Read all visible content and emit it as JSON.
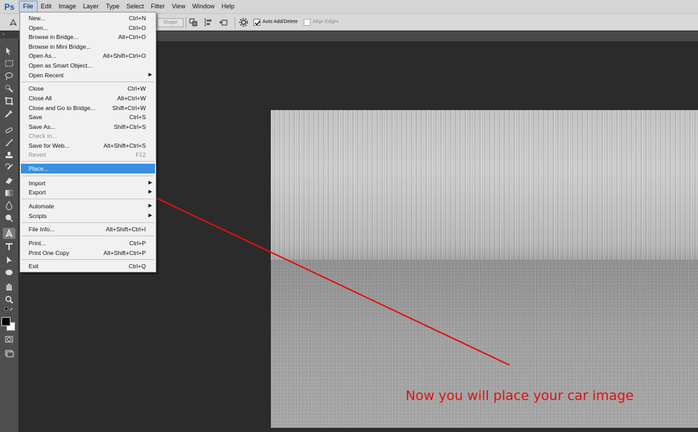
{
  "app": {
    "logo": "Ps"
  },
  "menubar": {
    "items": [
      "File",
      "Edit",
      "Image",
      "Layer",
      "Type",
      "Select",
      "Filter",
      "View",
      "Window",
      "Help"
    ]
  },
  "options": {
    "shape_label": "Shape",
    "auto_add_delete": "Auto Add/Delete",
    "auto_add_delete_checked": true,
    "align_edges": "Align Edges",
    "align_edges_checked": false
  },
  "file_menu": {
    "items": [
      {
        "label": "New...",
        "shortcut": "Ctrl+N"
      },
      {
        "label": "Open...",
        "shortcut": "Ctrl+O"
      },
      {
        "label": "Browse in Bridge...",
        "shortcut": "Alt+Ctrl+O"
      },
      {
        "label": "Browse in Mini Bridge...",
        "shortcut": ""
      },
      {
        "label": "Open As...",
        "shortcut": "Alt+Shift+Ctrl+O"
      },
      {
        "label": "Open as Smart Object...",
        "shortcut": ""
      },
      {
        "label": "Open Recent",
        "shortcut": "",
        "submenu": true
      },
      {
        "label": "Close",
        "shortcut": "Ctrl+W"
      },
      {
        "label": "Close All",
        "shortcut": "Alt+Ctrl+W"
      },
      {
        "label": "Close and Go to Bridge...",
        "shortcut": "Shift+Ctrl+W"
      },
      {
        "label": "Save",
        "shortcut": "Ctrl+S"
      },
      {
        "label": "Save As...",
        "shortcut": "Shift+Ctrl+S"
      },
      {
        "label": "Check In...",
        "shortcut": "",
        "disabled": true
      },
      {
        "label": "Save for Web...",
        "shortcut": "Alt+Shift+Ctrl+S"
      },
      {
        "label": "Revert",
        "shortcut": "F12",
        "disabled": true
      },
      {
        "label": "Place...",
        "shortcut": "",
        "highlighted": true
      },
      {
        "label": "Import",
        "shortcut": "",
        "submenu": true
      },
      {
        "label": "Export",
        "shortcut": "",
        "submenu": true
      },
      {
        "label": "Automate",
        "shortcut": "",
        "submenu": true
      },
      {
        "label": "Scripts",
        "shortcut": "",
        "submenu": true
      },
      {
        "label": "File Info...",
        "shortcut": "Alt+Shift+Ctrl+I"
      },
      {
        "label": "Print...",
        "shortcut": "Ctrl+P"
      },
      {
        "label": "Print One Copy",
        "shortcut": "Alt+Shift+Ctrl+P"
      },
      {
        "label": "Exit",
        "shortcut": "Ctrl+Q"
      }
    ]
  },
  "annotation": {
    "text": "Now you will place your car image",
    "color": "#e0100f"
  },
  "colors": {
    "highlight": "#3a90e0",
    "workspace": "#2b2b2b",
    "foreground_swatch": "#000000",
    "background_swatch": "#ffffff"
  }
}
